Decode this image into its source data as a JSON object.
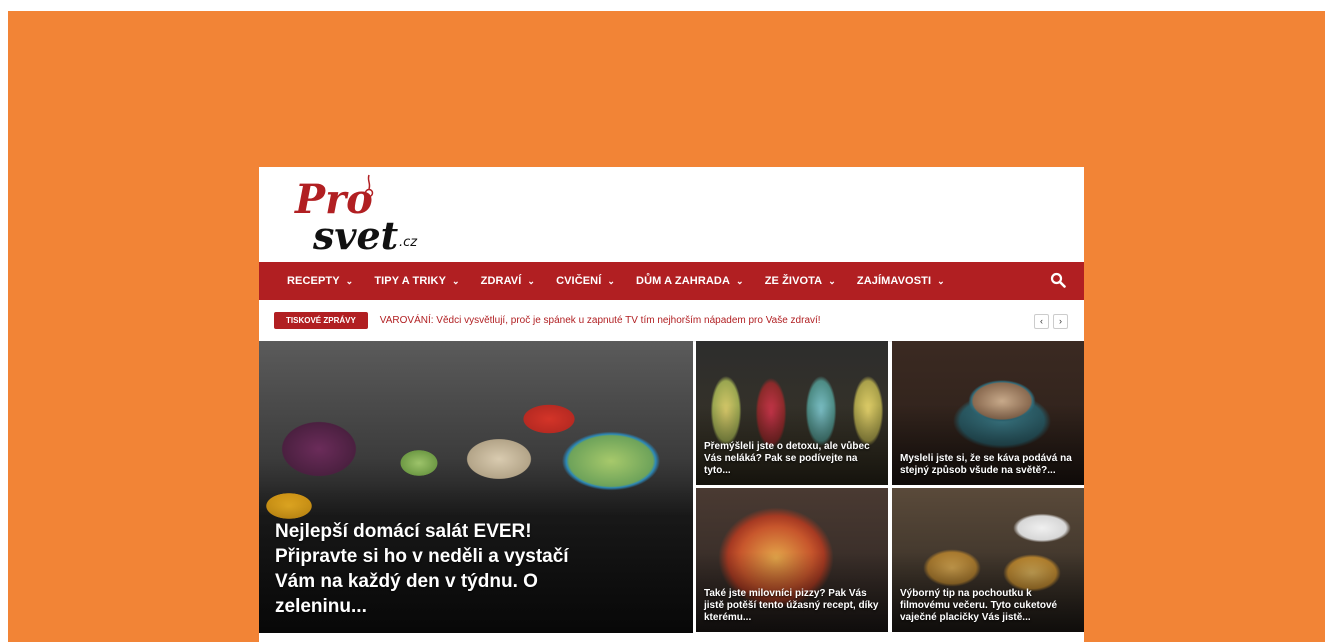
{
  "site": {
    "logo": {
      "line1": "Pro",
      "line2": "svet",
      "suffix": ".cz"
    },
    "nav": {
      "items": [
        {
          "label": "RECEPTY",
          "chevron": "⌄"
        },
        {
          "label": "TIPY A TRIKY",
          "chevron": "⌄"
        },
        {
          "label": "ZDRAVÍ",
          "chevron": "⌄"
        },
        {
          "label": "CVIČENÍ",
          "chevron": "⌄"
        },
        {
          "label": "DŮM A ZAHRADA",
          "chevron": "⌄"
        },
        {
          "label": "ZE ŽIVOTA",
          "chevron": "⌄"
        },
        {
          "label": "ZAJÍMAVOSTI",
          "chevron": "⌄"
        }
      ],
      "search_icon": "search-icon"
    },
    "ticker": {
      "badge": "TISKOVÉ ZPRÁVY",
      "headline": "VAROVÁNÍ: Vědci vysvětlují, proč je spánek u zapnuté TV tím nejhorším nápadem pro Vaše zdraví!",
      "prev": "‹",
      "next": "›"
    },
    "featured": {
      "hero": {
        "title": "Nejlepší domácí salát EVER! Připravte si ho v neděli a vystačí Vám na každý den v týdnu. O zeleninu..."
      },
      "tiles": [
        {
          "title": "Přemýšleli jste o detoxu, ale vůbec Vás neláká? Pak se podívejte na tyto..."
        },
        {
          "title": "Mysleli jste si, že se káva podává na stejný způsob všude na světě?..."
        },
        {
          "title": "Také jste milovníci pizzy? Pak Vás jistě potěší tento úžasný recept, díky kterému..."
        },
        {
          "title": "Výborný tip na pochoutku k filmovému večeru. Tyto cuketové vaječné placičky Vás jistě..."
        }
      ]
    }
  },
  "colors": {
    "background": "#f28436",
    "brand_red": "#b11f22",
    "white": "#ffffff"
  }
}
